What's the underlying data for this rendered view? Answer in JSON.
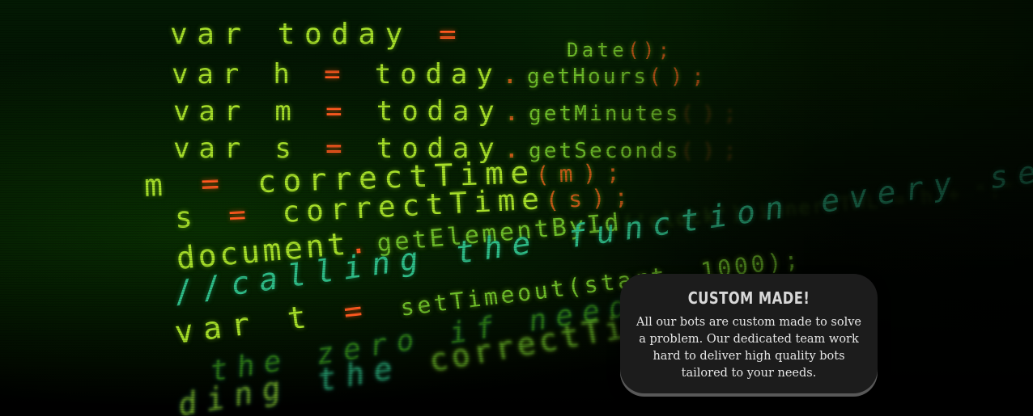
{
  "background_code": {
    "line1": [
      "var",
      "today",
      "=",
      "Date",
      "();"
    ],
    "line2": [
      "var",
      "h",
      "=",
      "today",
      ".",
      "getHours",
      "();"
    ],
    "line3": [
      "var",
      "m",
      "=",
      "today",
      ".",
      "getMinutes",
      "();"
    ],
    "line4": [
      "var",
      "s",
      "=",
      "today",
      ".",
      "getSeconds",
      "();"
    ],
    "line5": [
      "m",
      "=",
      "correctTime",
      "(m);"
    ],
    "line6": [
      "s",
      "=",
      "correctTime",
      "(s);"
    ],
    "line7": [
      "document",
      ".",
      "getElementById",
      "('clock').innerHTML = h + \":\""
    ],
    "line8": [
      "//calling the function every second",
      "setTimeout(start, 1000);"
    ],
    "line9": [
      "var",
      "t",
      "=",
      "setTimeout(start, 1000);"
    ],
    "line10": [
      "the zero if needed",
      "correctTime(i)"
    ],
    "line11": [
      "ding",
      "the",
      "correctTime"
    ]
  },
  "card": {
    "title": "CUSTOM MADE!",
    "text": "All our bots are custom made to solve a problem. Our dedicated team work hard to deliver high quality bots tailored to your needs."
  },
  "colors": {
    "code_green": "#a7e02a",
    "code_orange": "#ff5a1f",
    "card_bg": "#1c1c1c"
  }
}
